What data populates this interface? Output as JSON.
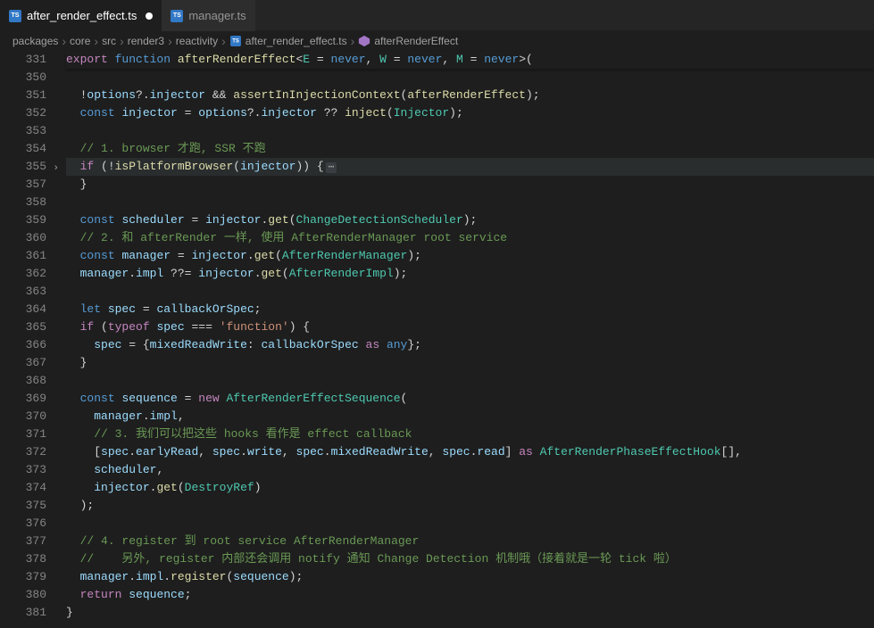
{
  "tabs": [
    {
      "label": "after_render_effect.ts",
      "dirty": true,
      "active": true
    },
    {
      "label": "manager.ts",
      "dirty": false,
      "active": false
    }
  ],
  "breadcrumbs": {
    "parts": [
      "packages",
      "core",
      "src",
      "render3",
      "reactivity",
      "after_render_effect.ts",
      "afterRenderEffect"
    ]
  },
  "lines": [
    {
      "num": "331",
      "sticky": true,
      "tokens": [
        [
          "kw",
          "export"
        ],
        [
          "op",
          " "
        ],
        [
          "kw2",
          "function"
        ],
        [
          "op",
          " "
        ],
        [
          "fn",
          "afterRenderEffect"
        ],
        [
          "op",
          "<"
        ],
        [
          "ty",
          "E"
        ],
        [
          "op",
          " = "
        ],
        [
          "kw2",
          "never"
        ],
        [
          "op",
          ", "
        ],
        [
          "ty",
          "W"
        ],
        [
          "op",
          " = "
        ],
        [
          "kw2",
          "never"
        ],
        [
          "op",
          ", "
        ],
        [
          "ty",
          "M"
        ],
        [
          "op",
          " = "
        ],
        [
          "kw2",
          "never"
        ],
        [
          "op",
          ">("
        ]
      ]
    },
    {
      "num": "350",
      "tokens": []
    },
    {
      "num": "351",
      "tokens": [
        [
          "op",
          "  !"
        ],
        [
          "var",
          "options"
        ],
        [
          "op",
          "?."
        ],
        [
          "var",
          "injector"
        ],
        [
          "op",
          " && "
        ],
        [
          "fn",
          "assertInInjectionContext"
        ],
        [
          "op",
          "("
        ],
        [
          "fn",
          "afterRenderEffect"
        ],
        [
          "op",
          ");"
        ]
      ]
    },
    {
      "num": "352",
      "tokens": [
        [
          "op",
          "  "
        ],
        [
          "kw2",
          "const"
        ],
        [
          "op",
          " "
        ],
        [
          "var",
          "injector"
        ],
        [
          "op",
          " = "
        ],
        [
          "var",
          "options"
        ],
        [
          "op",
          "?."
        ],
        [
          "var",
          "injector"
        ],
        [
          "op",
          " ?? "
        ],
        [
          "fn",
          "inject"
        ],
        [
          "op",
          "("
        ],
        [
          "ty",
          "Injector"
        ],
        [
          "op",
          ");"
        ]
      ]
    },
    {
      "num": "353",
      "tokens": []
    },
    {
      "num": "354",
      "tokens": [
        [
          "op",
          "  "
        ],
        [
          "cmt",
          "// 1. browser 才跑, SSR 不跑"
        ]
      ]
    },
    {
      "num": "355",
      "hl": true,
      "fold": ">",
      "tokens": [
        [
          "op",
          "  "
        ],
        [
          "kw",
          "if"
        ],
        [
          "op",
          " (!"
        ],
        [
          "fn",
          "isPlatformBrowser"
        ],
        [
          "op",
          "("
        ],
        [
          "var",
          "injector"
        ],
        [
          "op",
          ")) {"
        ],
        [
          "collapsed",
          "⋯"
        ]
      ]
    },
    {
      "num": "357",
      "tokens": [
        [
          "op",
          "  }"
        ]
      ]
    },
    {
      "num": "358",
      "tokens": []
    },
    {
      "num": "359",
      "tokens": [
        [
          "op",
          "  "
        ],
        [
          "kw2",
          "const"
        ],
        [
          "op",
          " "
        ],
        [
          "var",
          "scheduler"
        ],
        [
          "op",
          " = "
        ],
        [
          "var",
          "injector"
        ],
        [
          "op",
          "."
        ],
        [
          "fn",
          "get"
        ],
        [
          "op",
          "("
        ],
        [
          "ty",
          "ChangeDetectionScheduler"
        ],
        [
          "op",
          ");"
        ]
      ]
    },
    {
      "num": "360",
      "tokens": [
        [
          "op",
          "  "
        ],
        [
          "cmt",
          "// 2. 和 afterRender 一样, 使用 AfterRenderManager root service"
        ]
      ]
    },
    {
      "num": "361",
      "tokens": [
        [
          "op",
          "  "
        ],
        [
          "kw2",
          "const"
        ],
        [
          "op",
          " "
        ],
        [
          "var",
          "manager"
        ],
        [
          "op",
          " = "
        ],
        [
          "var",
          "injector"
        ],
        [
          "op",
          "."
        ],
        [
          "fn",
          "get"
        ],
        [
          "op",
          "("
        ],
        [
          "ty",
          "AfterRenderManager"
        ],
        [
          "op",
          ");"
        ]
      ]
    },
    {
      "num": "362",
      "tokens": [
        [
          "op",
          "  "
        ],
        [
          "var",
          "manager"
        ],
        [
          "op",
          "."
        ],
        [
          "var",
          "impl"
        ],
        [
          "op",
          " ??= "
        ],
        [
          "var",
          "injector"
        ],
        [
          "op",
          "."
        ],
        [
          "fn",
          "get"
        ],
        [
          "op",
          "("
        ],
        [
          "ty",
          "AfterRenderImpl"
        ],
        [
          "op",
          ");"
        ]
      ]
    },
    {
      "num": "363",
      "tokens": []
    },
    {
      "num": "364",
      "tokens": [
        [
          "op",
          "  "
        ],
        [
          "kw2",
          "let"
        ],
        [
          "op",
          " "
        ],
        [
          "var",
          "spec"
        ],
        [
          "op",
          " = "
        ],
        [
          "var",
          "callbackOrSpec"
        ],
        [
          "op",
          ";"
        ]
      ]
    },
    {
      "num": "365",
      "tokens": [
        [
          "op",
          "  "
        ],
        [
          "kw",
          "if"
        ],
        [
          "op",
          " ("
        ],
        [
          "kw",
          "typeof"
        ],
        [
          "op",
          " "
        ],
        [
          "var",
          "spec"
        ],
        [
          "op",
          " === "
        ],
        [
          "str",
          "'function'"
        ],
        [
          "op",
          ") {"
        ]
      ]
    },
    {
      "num": "366",
      "tokens": [
        [
          "op",
          "    "
        ],
        [
          "var",
          "spec"
        ],
        [
          "op",
          " = {"
        ],
        [
          "var",
          "mixedReadWrite"
        ],
        [
          "op",
          ": "
        ],
        [
          "var",
          "callbackOrSpec"
        ],
        [
          "op",
          " "
        ],
        [
          "kw",
          "as"
        ],
        [
          "op",
          " "
        ],
        [
          "kw2",
          "any"
        ],
        [
          "op",
          "};"
        ]
      ]
    },
    {
      "num": "367",
      "tokens": [
        [
          "op",
          "  }"
        ]
      ]
    },
    {
      "num": "368",
      "tokens": []
    },
    {
      "num": "369",
      "tokens": [
        [
          "op",
          "  "
        ],
        [
          "kw2",
          "const"
        ],
        [
          "op",
          " "
        ],
        [
          "var",
          "sequence"
        ],
        [
          "op",
          " = "
        ],
        [
          "kw",
          "new"
        ],
        [
          "op",
          " "
        ],
        [
          "ty",
          "AfterRenderEffectSequence"
        ],
        [
          "op",
          "("
        ]
      ]
    },
    {
      "num": "370",
      "tokens": [
        [
          "op",
          "    "
        ],
        [
          "var",
          "manager"
        ],
        [
          "op",
          "."
        ],
        [
          "var",
          "impl"
        ],
        [
          "op",
          ","
        ]
      ]
    },
    {
      "num": "371",
      "tokens": [
        [
          "op",
          "    "
        ],
        [
          "cmt",
          "// 3. 我们可以把这些 hooks 看作是 effect callback"
        ]
      ]
    },
    {
      "num": "372",
      "tokens": [
        [
          "op",
          "    ["
        ],
        [
          "var",
          "spec"
        ],
        [
          "op",
          "."
        ],
        [
          "var",
          "earlyRead"
        ],
        [
          "op",
          ", "
        ],
        [
          "var",
          "spec"
        ],
        [
          "op",
          "."
        ],
        [
          "var",
          "write"
        ],
        [
          "op",
          ", "
        ],
        [
          "var",
          "spec"
        ],
        [
          "op",
          "."
        ],
        [
          "var",
          "mixedReadWrite"
        ],
        [
          "op",
          ", "
        ],
        [
          "var",
          "spec"
        ],
        [
          "op",
          "."
        ],
        [
          "var",
          "read"
        ],
        [
          "op",
          "] "
        ],
        [
          "kw",
          "as"
        ],
        [
          "op",
          " "
        ],
        [
          "ty",
          "AfterRenderPhaseEffectHook"
        ],
        [
          "op",
          "[], "
        ]
      ]
    },
    {
      "num": "373",
      "tokens": [
        [
          "op",
          "    "
        ],
        [
          "var",
          "scheduler"
        ],
        [
          "op",
          ","
        ]
      ]
    },
    {
      "num": "374",
      "tokens": [
        [
          "op",
          "    "
        ],
        [
          "var",
          "injector"
        ],
        [
          "op",
          "."
        ],
        [
          "fn",
          "get"
        ],
        [
          "op",
          "("
        ],
        [
          "ty",
          "DestroyRef"
        ],
        [
          "op",
          ")",
          "]"
        ]
      ]
    },
    {
      "num": "375",
      "tokens": [
        [
          "op",
          "  );"
        ]
      ]
    },
    {
      "num": "376",
      "tokens": []
    },
    {
      "num": "377",
      "tokens": [
        [
          "op",
          "  "
        ],
        [
          "cmt",
          "// 4. register 到 root service AfterRenderManager"
        ]
      ]
    },
    {
      "num": "378",
      "tokens": [
        [
          "op",
          "  "
        ],
        [
          "cmt",
          "//    另外, register 内部还会调用 notify 通知 Change Detection 机制哦（接着就是一轮 tick 啦）"
        ]
      ]
    },
    {
      "num": "379",
      "tokens": [
        [
          "op",
          "  "
        ],
        [
          "var",
          "manager"
        ],
        [
          "op",
          "."
        ],
        [
          "var",
          "impl"
        ],
        [
          "op",
          "."
        ],
        [
          "fn",
          "register"
        ],
        [
          "op",
          "("
        ],
        [
          "var",
          "sequence"
        ],
        [
          "op",
          ");"
        ]
      ]
    },
    {
      "num": "380",
      "tokens": [
        [
          "op",
          "  "
        ],
        [
          "kw",
          "return"
        ],
        [
          "op",
          " "
        ],
        [
          "var",
          "sequence"
        ],
        [
          "op",
          ";"
        ]
      ]
    },
    {
      "num": "381",
      "tokens": [
        [
          "op",
          "}"
        ]
      ]
    }
  ]
}
